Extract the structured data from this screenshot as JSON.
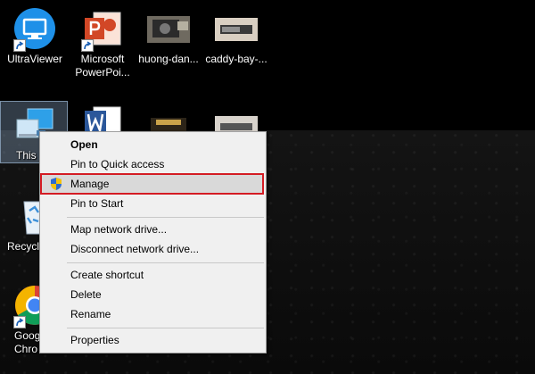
{
  "desktop": {
    "icons": [
      {
        "label": "UltraViewer"
      },
      {
        "label": "Microsoft\nPowerPoi..."
      },
      {
        "label": "huong-dan..."
      },
      {
        "label": "caddy-bay-..."
      },
      {
        "label": "This"
      },
      {
        "label": "Recycl"
      },
      {
        "label": "Goog\nChro"
      }
    ]
  },
  "context_menu": {
    "items": [
      {
        "label": "Open"
      },
      {
        "label": "Pin to Quick access"
      },
      {
        "label": "Manage"
      },
      {
        "label": "Pin to Start"
      },
      {
        "label": "Map network drive..."
      },
      {
        "label": "Disconnect network drive..."
      },
      {
        "label": "Create shortcut"
      },
      {
        "label": "Delete"
      },
      {
        "label": "Rename"
      },
      {
        "label": "Properties"
      }
    ],
    "highlight_color": "#d41c24"
  }
}
